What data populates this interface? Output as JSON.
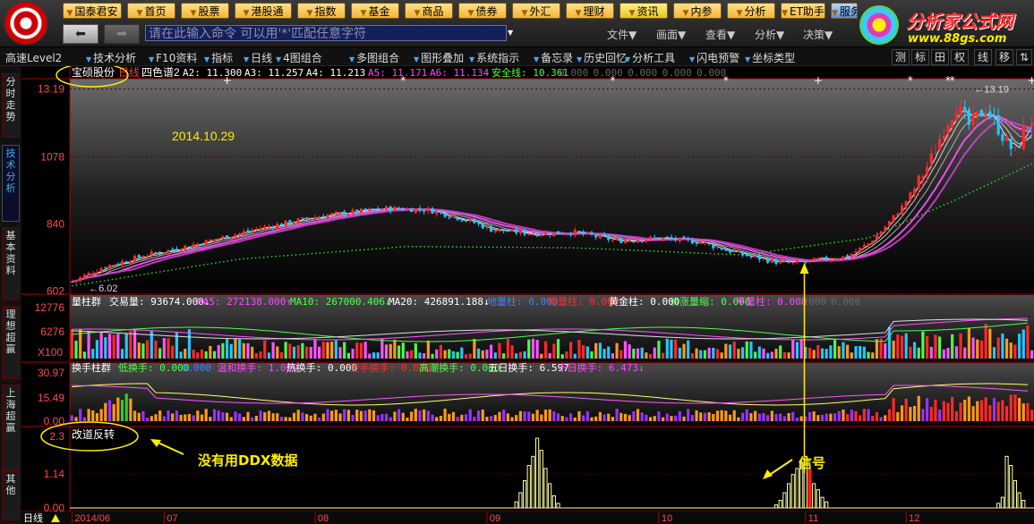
{
  "topnav": [
    {
      "label": "国泰君安",
      "x": 70,
      "w": 66
    },
    {
      "label": "首页",
      "x": 142,
      "w": 54
    },
    {
      "label": "股票",
      "x": 202,
      "w": 54
    },
    {
      "label": "港股通",
      "x": 262,
      "w": 64
    },
    {
      "label": "指数",
      "x": 332,
      "w": 54
    },
    {
      "label": "基金",
      "x": 392,
      "w": 54
    },
    {
      "label": "商品",
      "x": 452,
      "w": 54
    },
    {
      "label": "债券",
      "x": 512,
      "w": 54
    },
    {
      "label": "外汇",
      "x": 572,
      "w": 54
    },
    {
      "label": "理财",
      "x": 632,
      "w": 54
    },
    {
      "label": "资讯",
      "x": 692,
      "w": 54
    },
    {
      "label": "内参",
      "x": 752,
      "w": 54
    },
    {
      "label": "分析",
      "x": 812,
      "w": 54
    },
    {
      "label": "ET助手",
      "x": 872,
      "w": 50
    },
    {
      "label": "服务",
      "x": 928,
      "w": 30
    }
  ],
  "command_placeholder": "请在此输入命令    可以用'*'匹配任意字符",
  "menus": [
    "文件",
    "画面",
    "查看",
    "分析",
    "决策"
  ],
  "brand": {
    "name": "分析家公式网",
    "url": "www.88gs.com"
  },
  "toolbar": [
    "高速Level2",
    "技术分析",
    "F10资料",
    "指标",
    "日线",
    "4图组合",
    "多图组合",
    "图形叠加",
    "系统指示",
    "备忘录",
    "历史回忆",
    "分析工具",
    "闪电预警",
    "坐标类型"
  ],
  "toolbar_right": [
    "测",
    "标",
    "田",
    "权",
    "线",
    "移",
    "⇅"
  ],
  "side_tabs": [
    "分时走势",
    "技术分析",
    "基本资料",
    "理想超赢",
    "上海超赢",
    "其他"
  ],
  "colors": {
    "up": "#ff2a2a",
    "down": "#22c8ff",
    "grid": "#7a0000",
    "axis": "#aa0000",
    "accent": "#ffd700",
    "mid": "#0a0a0a"
  },
  "chart_data": [
    {
      "type": "candlestick",
      "title": "宝硕股份",
      "period": "日线",
      "indicator": "四色谱2",
      "legend": [
        "A2: 11.300",
        "A3: 11.257",
        "A4: 11.213",
        "A5: 11.171",
        "A6: 11.134",
        "安全线: 10.361",
        "0.000",
        "0.000",
        "0.000",
        "0.000",
        "0.000"
      ],
      "legend_colors": [
        "#ffffff",
        "#ffffff",
        "#ffffff",
        "#ff44ff",
        "#ff44ff",
        "#4cff4c",
        "#666666",
        "#666666",
        "#666666",
        "#666666",
        "#666666"
      ],
      "y_ticks": [
        13.19,
        10.78,
        8.4,
        6.02
      ],
      "y_tick_labels": [
        "13.19",
        "1078",
        "840",
        "602"
      ],
      "ylim": [
        6.0,
        13.3
      ],
      "annotations": {
        "date": "2014.10.29",
        "low": "6.02",
        "high": "13.19"
      },
      "x_labels": [
        "2014/06",
        "07",
        "08",
        "09",
        "10",
        "11",
        "12"
      ],
      "x_label_index": [
        0,
        22,
        58,
        99,
        140,
        175,
        199
      ],
      "n": 230,
      "anchors": [
        [
          0,
          6.35
        ],
        [
          8,
          6.9
        ],
        [
          18,
          7.3
        ],
        [
          30,
          7.7
        ],
        [
          45,
          8.25
        ],
        [
          60,
          8.7
        ],
        [
          75,
          8.95
        ],
        [
          85,
          8.9
        ],
        [
          95,
          8.5
        ],
        [
          100,
          8.2
        ],
        [
          110,
          8.05
        ],
        [
          120,
          8.1
        ],
        [
          130,
          7.8
        ],
        [
          140,
          7.9
        ],
        [
          150,
          7.75
        ],
        [
          160,
          7.3
        ],
        [
          168,
          7.05
        ],
        [
          172,
          7.0
        ],
        [
          180,
          7.15
        ],
        [
          185,
          7.25
        ],
        [
          190,
          7.7
        ],
        [
          194,
          8.3
        ],
        [
          198,
          9.0
        ],
        [
          202,
          9.9
        ],
        [
          205,
          10.7
        ],
        [
          208,
          11.8
        ],
        [
          211,
          12.6
        ],
        [
          214,
          11.9
        ],
        [
          218,
          12.5
        ],
        [
          221,
          11.8
        ],
        [
          223,
          11.3
        ],
        [
          225,
          10.9
        ],
        [
          227,
          11.7
        ],
        [
          230,
          12.3
        ]
      ],
      "safety_line": [
        [
          0,
          6.2
        ],
        [
          40,
          7.15
        ],
        [
          80,
          7.6
        ],
        [
          120,
          7.55
        ],
        [
          160,
          7.3
        ],
        [
          190,
          7.9
        ],
        [
          210,
          9.2
        ],
        [
          230,
          10.6
        ]
      ],
      "vol_label": "量柱群",
      "vol_legend": [
        "交易量: 93674.000↓",
        "MA5: 272138.000↑",
        "MA10: 267000.406↓",
        "MA20: 426891.188↓",
        "地量柱: 0.000",
        "倍量柱: 0.000",
        "黄金柱: 0.000",
        "价涨量缩: 0.000",
        "平量柱: 0.000",
        "0.000",
        "0.000"
      ],
      "vol_legend_colors": [
        "#ffffff",
        "#ff44ff",
        "#4cff4c",
        "#ffffff",
        "#3f7fff",
        "#ff2a2a",
        "#ffffff",
        "#4cff4c",
        "#ff44ff",
        "#666666",
        "#666666"
      ],
      "vol_ticks": [
        "12776",
        "6276",
        "X100"
      ],
      "turn_label": "换手柱群",
      "turn_legend": [
        "低换手: 0.000",
        "0.000",
        "温和换手: 1.000",
        "热换手: 0.000",
        "烫手换手: 0.000",
        "高潮换手: 0.000",
        "五日换手: 6.597",
        "十日换手: 6.473↓"
      ],
      "turn_legend_colors": [
        "#4cff4c",
        "#3f7fff",
        "#ff44ff",
        "#ffffff",
        "#ff2a2a",
        "#4cff4c",
        "#ffffff",
        "#ff44ff"
      ],
      "turn_ticks": [
        "30.97",
        "15.49",
        "0.00"
      ],
      "sig_label": "改道反转",
      "sig_ticks": [
        "2.3",
        "1.14",
        "0.00"
      ],
      "sig_groups": [
        {
          "start": 106,
          "values": [
            0.2,
            0.5,
            0.9,
            1.4,
            1.7,
            2.3,
            1.9,
            1.3,
            0.8,
            0.4,
            0.15
          ]
        },
        {
          "start": 168,
          "values": [
            0.1,
            0.25,
            0.5,
            0.8,
            1.1,
            1.3,
            1.5,
            1.7,
            1.25,
            0.8,
            0.6,
            0.35,
            0.2
          ]
        },
        {
          "start": 221,
          "values": [
            0.15,
            0.35,
            1.7,
            1.4,
            0.9,
            0.5,
            0.25
          ]
        }
      ],
      "signal_index": 176
    }
  ],
  "callouts": {
    "no_ddx": "没有用DDX数据",
    "signal": "信号"
  },
  "status": "日线"
}
